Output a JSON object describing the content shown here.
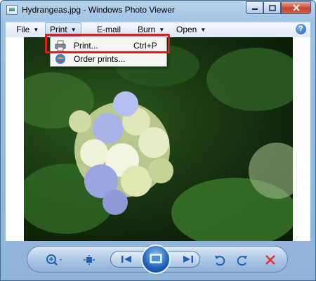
{
  "window": {
    "title": "Hydrangeas.jpg - Windows Photo Viewer",
    "icon": "photo-viewer-app-icon",
    "caption_buttons": [
      "minimize-icon",
      "maximize-icon",
      "close-icon"
    ]
  },
  "menubar": {
    "items": [
      {
        "label": "File",
        "has_arrow": true
      },
      {
        "label": "Print",
        "has_arrow": true,
        "active": true
      },
      {
        "label": "E-mail",
        "has_arrow": false
      },
      {
        "label": "Burn",
        "has_arrow": true
      },
      {
        "label": "Open",
        "has_arrow": true
      }
    ],
    "help_label": "?"
  },
  "print_menu": {
    "items": [
      {
        "label": "Print...",
        "shortcut": "Ctrl+P",
        "icon": "printer-icon",
        "highlighted": true
      },
      {
        "label": "Order prints...",
        "shortcut": "",
        "icon": "order-prints-icon",
        "highlighted": false
      }
    ]
  },
  "image": {
    "name": "Hydrangeas.jpg",
    "subject": "hydrangea-flower-photo"
  },
  "toolbar": {
    "buttons": [
      "zoom-icon",
      "actual-size-icon",
      "previous-icon",
      "slideshow-icon",
      "next-icon",
      "rotate-counterclockwise-icon",
      "rotate-clockwise-icon",
      "delete-icon"
    ]
  },
  "colors": {
    "highlight_border": "#e01c1c",
    "delete_red": "#e03030",
    "toolbar_blue": "#1c61b8"
  }
}
